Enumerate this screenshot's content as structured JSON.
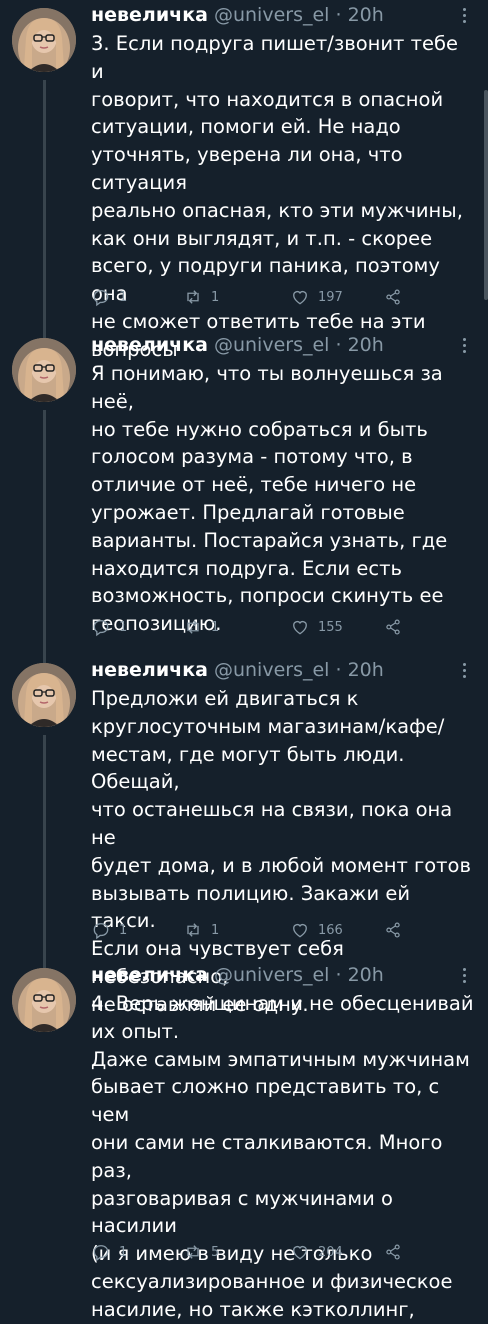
{
  "tweets": [
    {
      "name": "невеличка",
      "handle": "@univers_el",
      "dot": "·",
      "time": "20h",
      "text": "3. Если подруга пишет/звонит тебе и\nговорит, что находится в опасной\nситуации, помоги ей. Не надо\nуточнять, уверена ли она, что ситуация\nреально опасная, кто эти мужчины,\nкак они выглядят, и т.п. - скорее\nвсего, у подруги паника, поэтому она\nне сможет ответить тебе на эти\nвопросы",
      "replies": "1",
      "retweets": "1",
      "likes": "197"
    },
    {
      "name": "невеличка",
      "handle": "@univers_el",
      "dot": "·",
      "time": "20h",
      "text": "Я понимаю, что ты волнуешься за неё,\nно тебе нужно собраться и быть\nголосом разума - потому что, в\nотличие от неё, тебе ничего не\nугрожает. Предлагай готовые\nварианты. Постарайся узнать, где\nнаходится подруга. Если есть\nвозможность, попроси скинуть ее\nгеопозицию.",
      "replies": "1",
      "retweets": "1",
      "likes": "155"
    },
    {
      "name": "невеличка",
      "handle": "@univers_el",
      "dot": "·",
      "time": "20h",
      "text": "Предложи ей двигаться к\nкруглосуточным магазинам/кафе/\nместам, где могут быть люди. Обещай,\nчто останешься на связи, пока она не\nбудет дома, и в любой момент готов\nвызывать полицию. Закажи ей такси.\nЕсли она чувствует себя небезопасно,\nне оставляй ее одну.",
      "replies": "1",
      "retweets": "1",
      "likes": "166"
    },
    {
      "name": "невеличка",
      "handle": "@univers_el",
      "dot": "·",
      "time": "20h",
      "text": "4. Верь женщинам и не обесценивай\nих опыт.\nДаже самым эмпатичным мужчинам\nбывает сложно представить то, с чем\nони сами не сталкиваются. Много раз,\nразговаривая с мужчинами о насилии\n(и я имею в виду не только\nсексуализированное и физическое\nнасилие, но также кэтколлинг,",
      "replies": "1",
      "retweets": "5",
      "likes": "204"
    }
  ],
  "icons": {
    "reply": "reply-icon",
    "retweet": "retweet-icon",
    "like": "heart-icon",
    "share": "share-icon",
    "more": "more-icon"
  },
  "colors": {
    "background": "#15202b",
    "text": "#ffffff",
    "secondary": "#8899a6",
    "divider": "#38444d"
  }
}
